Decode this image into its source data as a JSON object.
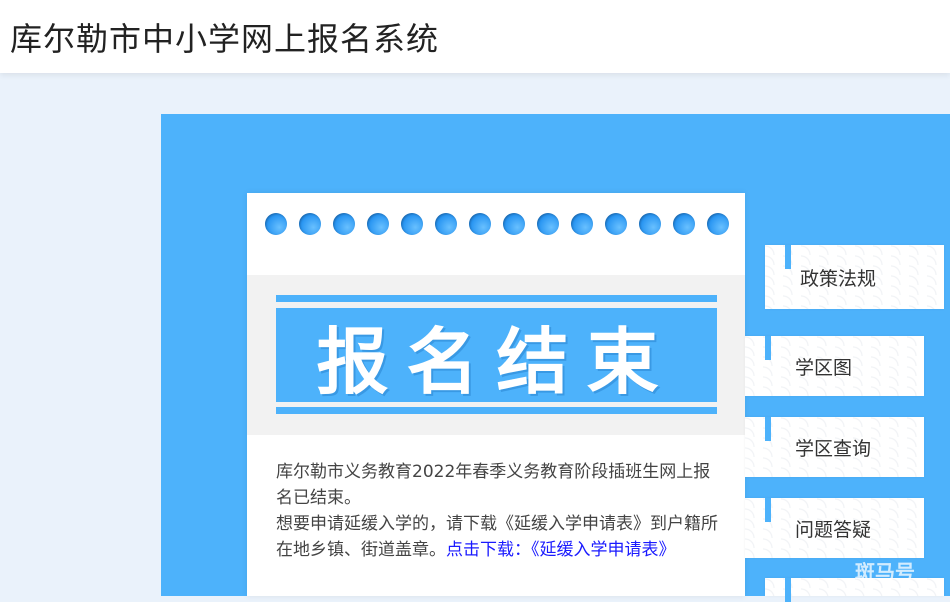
{
  "header": {
    "title": "库尔勒市中小学网上报名系统"
  },
  "card": {
    "banner": "报名结束",
    "notice": {
      "line1": "库尔勒市义务教育2022年春季义务教育阶段插班生网上报名已结束。",
      "line2_prefix": "想要申请延缓入学的，请下载《延缓入学申请表》到户籍所在地乡镇、街道盖章。",
      "download_link": "点击下载：《延缓入学申请表》"
    }
  },
  "menu": {
    "items": [
      {
        "label": "政策法规"
      },
      {
        "label": "学区图"
      },
      {
        "label": "学区查询"
      },
      {
        "label": "问题答疑"
      }
    ]
  },
  "watermark": "斑马号",
  "colors": {
    "accent": "#4db2fb",
    "background": "#eaf2fb",
    "link": "#1a1aff"
  }
}
